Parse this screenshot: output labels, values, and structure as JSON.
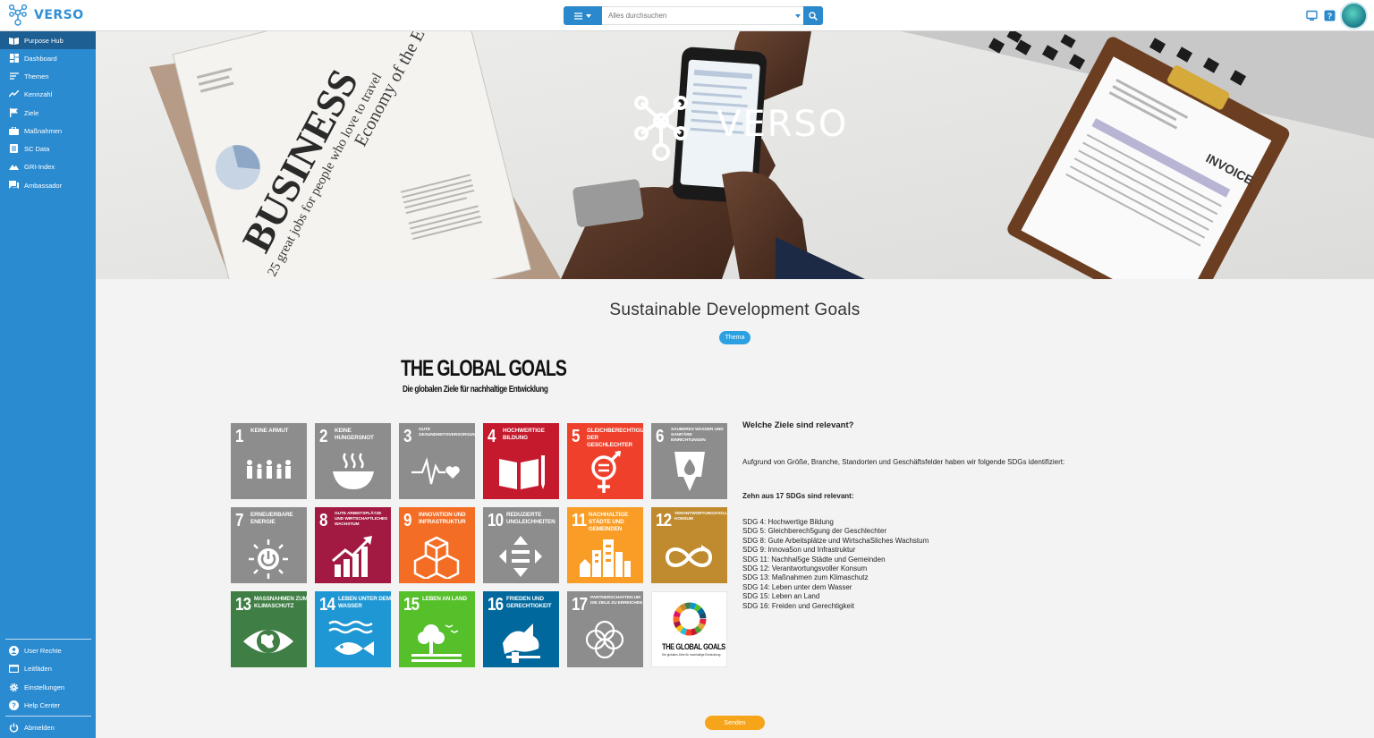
{
  "app": {
    "brand": "VERSO"
  },
  "search": {
    "placeholder": "Alles durchsuchen"
  },
  "sidebar": {
    "items": [
      {
        "label": "Purpose Hub",
        "icon": "book-open-icon"
      },
      {
        "label": "Dashboard",
        "icon": "dashboard-icon"
      },
      {
        "label": "Themen",
        "icon": "list-lines-icon"
      },
      {
        "label": "Kennzahl",
        "icon": "trend-line-icon"
      },
      {
        "label": "Ziele",
        "icon": "flag-icon"
      },
      {
        "label": "Maßnahmen",
        "icon": "briefcase-icon"
      },
      {
        "label": "SC Data",
        "icon": "document-list-icon"
      },
      {
        "label": "GRI-Index",
        "icon": "mountain-chart-icon"
      },
      {
        "label": "Ambassador",
        "icon": "chat-bubble-icon"
      }
    ],
    "bottom": [
      {
        "label": "User Rechte",
        "icon": "user-circle-icon"
      },
      {
        "label": "Leitfäden",
        "icon": "window-icon"
      },
      {
        "label": "Einstellungen",
        "icon": "gear-icon"
      },
      {
        "label": "Help Center",
        "icon": "help-circle-icon"
      }
    ],
    "logout": {
      "label": "Abmelden",
      "icon": "power-icon"
    }
  },
  "hero": {
    "brand": "VERSO",
    "newspaper": {
      "headline": "BUSINESS",
      "title": "Economy of the European Union",
      "sub": "25 great jobs for people who love to travel"
    },
    "clipboard_label": "INVOICE"
  },
  "main": {
    "title": "Sustainable Development Goals",
    "tag": "Thema",
    "goals_title": "THE GLOBAL GOALS",
    "goals_subtitle": "Die globalen Ziele für nachhaltige Entwicklung",
    "tiles": [
      {
        "num": "1",
        "name": "Keine Armut",
        "color": "#8d8d8d",
        "icon": "family-icon"
      },
      {
        "num": "2",
        "name": "Keine Hungersnot",
        "color": "#8d8d8d",
        "icon": "bowl-icon"
      },
      {
        "num": "3",
        "name": "Gute Gesundheitsversorgung",
        "color": "#8d8d8d",
        "icon": "heartbeat-icon"
      },
      {
        "num": "4",
        "name": "Hochwertige Bildung",
        "color": "#c5192d",
        "icon": "book-pencil-icon"
      },
      {
        "num": "5",
        "name": "Gleichberechtigung der Geschlechter",
        "color": "#ef402c",
        "icon": "gender-equality-icon"
      },
      {
        "num": "6",
        "name": "Sauberes Wasser und sanitäre Einrichtungen",
        "color": "#8d8d8d",
        "icon": "water-drop-icon"
      },
      {
        "num": "7",
        "name": "Erneuerbare Energie",
        "color": "#8d8d8d",
        "icon": "sun-power-icon"
      },
      {
        "num": "8",
        "name": "Gute Arbeitsplätze und wirtschaftliches Wachstum",
        "color": "#a21942",
        "icon": "growth-chart-icon"
      },
      {
        "num": "9",
        "name": "Innovation und Infrastruktur",
        "color": "#f36d25",
        "icon": "cubes-icon"
      },
      {
        "num": "10",
        "name": "Reduzierte Ungleichheiten",
        "color": "#8d8d8d",
        "icon": "equality-arrows-icon"
      },
      {
        "num": "11",
        "name": "Nachhaltige Städte und Gemeinden",
        "color": "#f99d26",
        "icon": "city-icon"
      },
      {
        "num": "12",
        "name": "Verantwortungsvoller Konsum",
        "color": "#bf8b2e",
        "icon": "infinity-icon"
      },
      {
        "num": "13",
        "name": "Maßnahmen zum Klimaschutz",
        "color": "#3f7e44",
        "icon": "eye-globe-icon"
      },
      {
        "num": "14",
        "name": "Leben unter dem Wasser",
        "color": "#1f97d4",
        "icon": "fish-icon"
      },
      {
        "num": "15",
        "name": "Leben an Land",
        "color": "#56c02b",
        "icon": "tree-icon"
      },
      {
        "num": "16",
        "name": "Frieden und Gerechtigkeit",
        "color": "#00689d",
        "icon": "dove-icon"
      },
      {
        "num": "17",
        "name": "Partnerschaften um die Ziele zu erreichen",
        "color": "#8d8d8d",
        "icon": "rings-icon"
      }
    ],
    "logo_tile": {
      "title": "THE GLOBAL GOALS",
      "subtitle": "Die globalen Ziele für nachhaltige Entwicklung",
      "icon": "sdg-wheel-icon"
    },
    "info": {
      "question": "Welche Ziele sind relevant?",
      "intro": "Aufgrund von Größe, Branche, Standorten und Geschäftsfelder haben wir folgende SDGs identifiziert:",
      "heading": "Zehn aus 17 SDGs sind relevant:",
      "list": [
        "SDG 4: Hochwertige Bildung",
        "SDG 5: Gleichberech5gung der Geschlechter",
        "SDG 8: Gute Arbeitsplätze und WirtschaSliches Wachstum",
        "SDG 9: Innova5on und Infrastruktur",
        "SDG 11: Nachhal5ge Städte und Gemeinden",
        "SDG 12: Verantwortungsvoller Konsum",
        "SDG 13: Maßnahmen zum Klimaschutz",
        "SDG 14: Leben unter dem Wasser",
        "SDG 15: Leben an Land",
        "SDG 16: Freiden und Gerechtigkeit"
      ]
    },
    "submit_label": "Senden"
  },
  "colors": {
    "sidebar": "#2b8bd1",
    "sidebar_active": "#1d5f93",
    "accent": "#2a88cc",
    "submit": "#f6a51a",
    "tag": "#2ba1e2"
  }
}
